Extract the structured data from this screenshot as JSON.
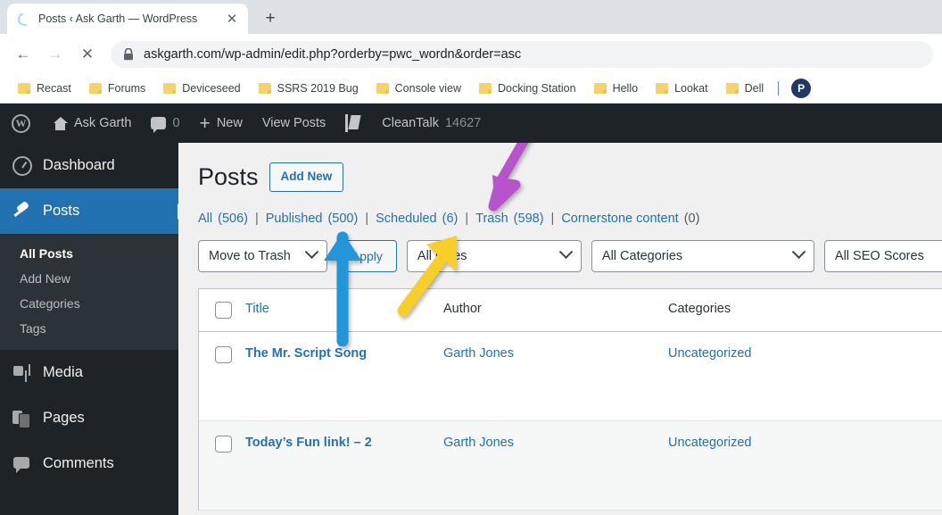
{
  "browser": {
    "tab": {
      "title": "Posts ‹ Ask Garth — WordPress",
      "close_label": "✕",
      "spinner": "loading-spinner"
    },
    "new_tab_label": "+",
    "nav": {
      "back": "←",
      "forward": "→",
      "stop": "✕"
    },
    "omnibox": {
      "lock": "🔒",
      "url": "askgarth.com/wp-admin/edit.php?orderby=pwc_wordn&order=asc"
    },
    "bookmarks": [
      {
        "label": "Recast"
      },
      {
        "label": "Forums"
      },
      {
        "label": "Deviceseed"
      },
      {
        "label": "SSRS 2019 Bug"
      },
      {
        "label": "Console view"
      },
      {
        "label": "Docking Station"
      },
      {
        "label": "Hello"
      },
      {
        "label": "Lookat"
      },
      {
        "label": "Dell"
      }
    ],
    "profile_initial": "P"
  },
  "adminbar": {
    "site_name": "Ask Garth",
    "comments_count": "0",
    "new_label": "New",
    "view_posts_label": "View Posts",
    "cleantalk_label": "CleanTalk",
    "cleantalk_count": "14627"
  },
  "sidebar": {
    "items": [
      {
        "label": "Dashboard",
        "icon": "dashboard-icon",
        "active": false
      },
      {
        "label": "Posts",
        "icon": "pin-icon",
        "active": true
      },
      {
        "label": "Media",
        "icon": "media-icon",
        "active": false
      },
      {
        "label": "Pages",
        "icon": "pages-icon",
        "active": false
      },
      {
        "label": "Comments",
        "icon": "comments-icon",
        "active": false
      }
    ],
    "posts_submenu": [
      {
        "label": "All Posts",
        "current": true
      },
      {
        "label": "Add New",
        "current": false
      },
      {
        "label": "Categories",
        "current": false
      },
      {
        "label": "Tags",
        "current": false
      }
    ]
  },
  "main": {
    "page_title": "Posts",
    "add_new_label": "Add New",
    "status_filters": [
      {
        "label": "All",
        "count": "(506)",
        "muted": false
      },
      {
        "label": "Published",
        "count": "(500)",
        "muted": false
      },
      {
        "label": "Scheduled",
        "count": "(6)",
        "muted": false
      },
      {
        "label": "Trash",
        "count": "(598)",
        "muted": false
      },
      {
        "label": "Cornerstone content",
        "count": "(0)",
        "muted": true
      }
    ],
    "separator": "|",
    "toolbar": {
      "bulk_action": "Move to Trash",
      "apply_label": "Apply",
      "date_filter": "All dates",
      "category_filter": "All Categories",
      "seo_filter": "All SEO Scores"
    },
    "table": {
      "columns": {
        "title": "Title",
        "author": "Author",
        "categories": "Categories"
      },
      "rows": [
        {
          "title": "The Mr. Script Song",
          "author": "Garth Jones",
          "categories": "Uncategorized"
        },
        {
          "title": "Today’s Fun link! – 2",
          "author": "Garth Jones",
          "categories": "Uncategorized"
        }
      ]
    }
  },
  "annotations": [
    {
      "name": "purple-arrow-trash",
      "color": "#b654cc",
      "points_to": "Trash (598)"
    },
    {
      "name": "blue-arrow-apply",
      "color": "#2196d8",
      "points_to": "Apply button"
    },
    {
      "name": "yellow-arrow-dates",
      "color": "#f7cf2b",
      "points_to": "All dates dropdown"
    }
  ]
}
